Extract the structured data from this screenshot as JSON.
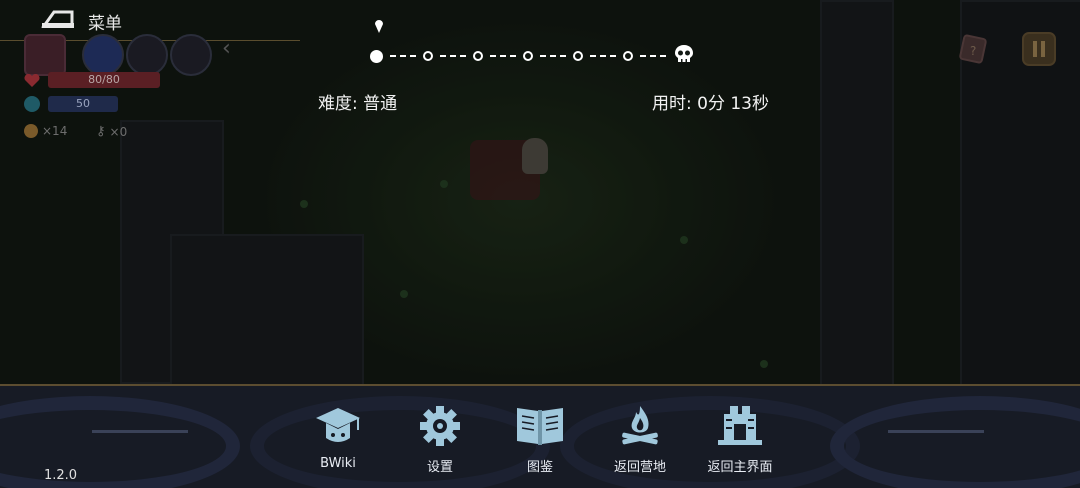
{
  "menu": {
    "label": "菜单"
  },
  "status": {
    "hp": "80/80",
    "mp": "50",
    "coins": "×14",
    "keys": "×0"
  },
  "run": {
    "difficulty": "难度: 普通",
    "time": "用时: 0分 13秒"
  },
  "bottom_menu": {
    "items": [
      {
        "label": "BWiki",
        "icon": "graduation-cap-icon"
      },
      {
        "label": "设置",
        "icon": "gear-icon"
      },
      {
        "label": "图鉴",
        "icon": "open-book-icon"
      },
      {
        "label": "返回营地",
        "icon": "campfire-icon"
      },
      {
        "label": "返回主界面",
        "icon": "gate-icon"
      }
    ]
  },
  "version": "1.2.0",
  "colors": {
    "hp": "#5a1f24",
    "mp": "#1f2a4a",
    "accent": "#a0c8dc",
    "bar_bg": "#171b25"
  }
}
